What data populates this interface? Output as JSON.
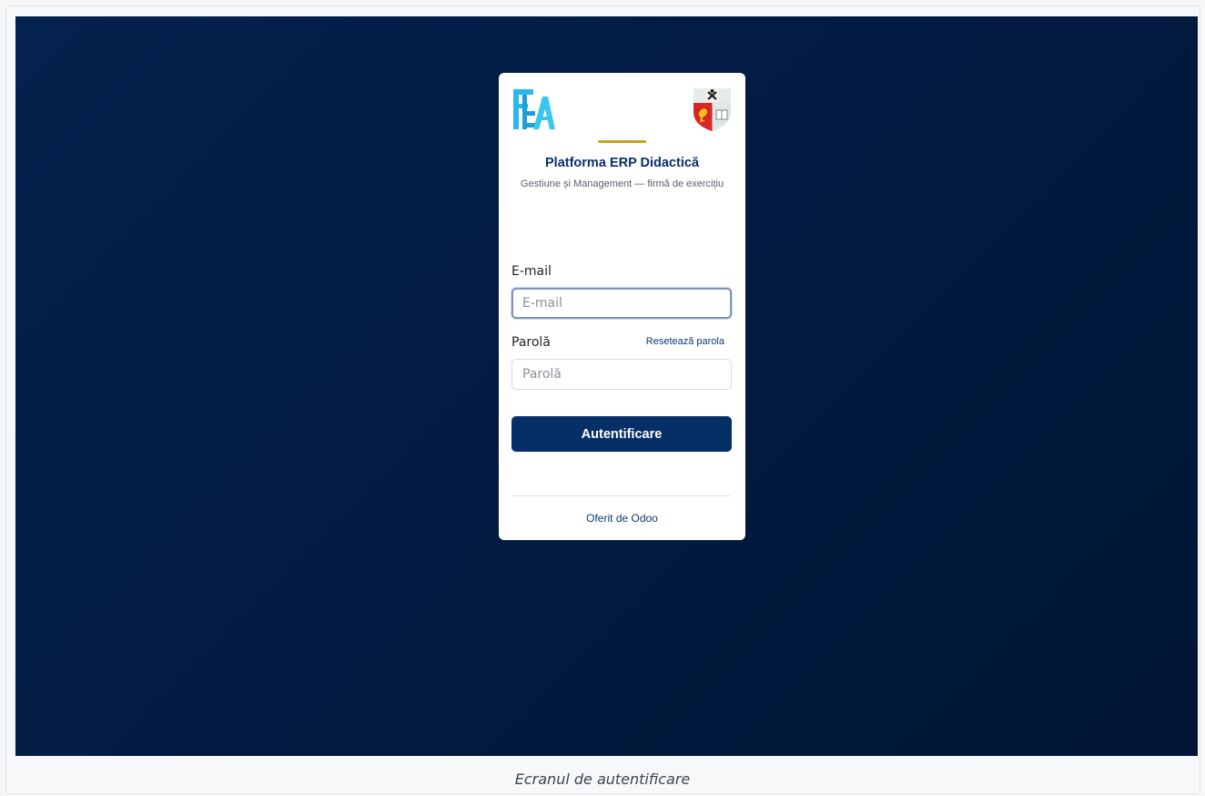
{
  "login": {
    "title": "Platforma ERP Didactică",
    "subtitle": "Gestiune și Management — firmă de exercițiu",
    "email_label": "E-mail",
    "email_placeholder": "E-mail",
    "email_value": "",
    "password_label": "Parolă",
    "password_placeholder": "Parolă",
    "password_value": "",
    "reset_link": "Resetează parola",
    "submit_label": "Autentificare",
    "powered_by": "Oferit de Odoo"
  },
  "logos": {
    "left": "FEAA-logo",
    "right": "university-crest-logo"
  },
  "caption": "Ecranul de autentificare",
  "colors": {
    "background": "#021b42",
    "primary": "#062f68",
    "accent_gold": "#c9a227",
    "title": "#0a3068"
  }
}
